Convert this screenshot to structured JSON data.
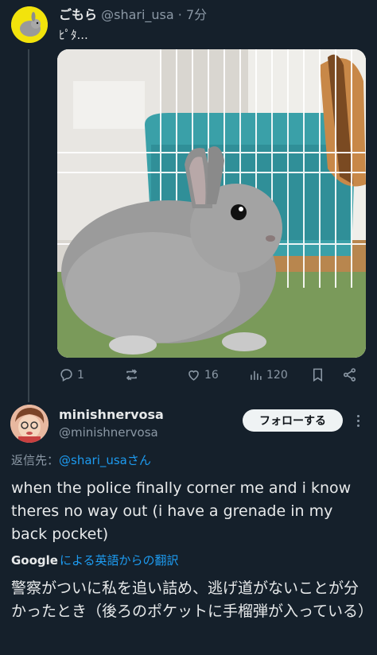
{
  "tweet": {
    "display_name": "ごもら",
    "handle": "@shari_usa",
    "separator": "·",
    "time": "7分",
    "text": "ﾋﾟﾀ...",
    "image_icon": "rabbit-photo",
    "stats": {
      "replies": "1",
      "retweets": "",
      "likes": "16",
      "views": "120"
    }
  },
  "reply": {
    "display_name": "minishnervosa",
    "handle": "@minishnervosa",
    "follow_label": "フォローする",
    "reply_to_prefix": "返信先：",
    "reply_to_handle": "@shari_usa",
    "reply_to_suffix": "さん",
    "text": "when the police finally corner me and i know theres no way out (i have a grenade in my back pocket)",
    "google_label": "Google",
    "translation_label": "による英語からの翻訳",
    "translated_text": "警察がついに私を追い詰め、逃げ道がないことが分かったとき（後ろのポケットに手榴弾が入っている）"
  },
  "colors": {
    "background": "#15202b",
    "link": "#1d9bf0",
    "muted": "#8b98a5",
    "text": "#e7e9ea"
  }
}
